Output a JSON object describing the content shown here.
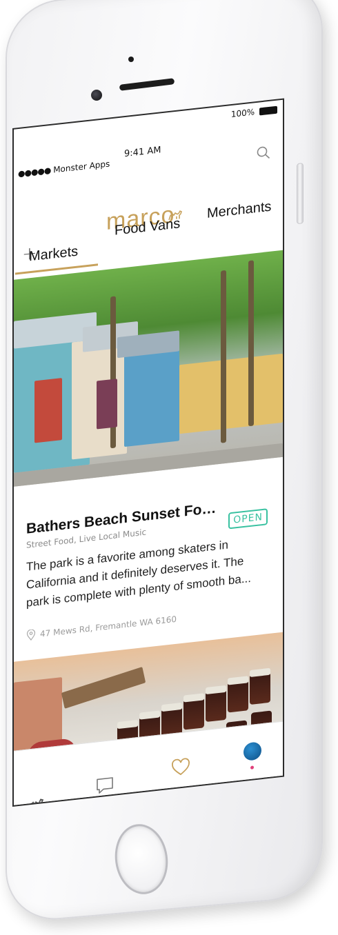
{
  "status_bar": {
    "carrier": "Monster Apps",
    "signal_dots": "●●●●●",
    "time": "9:41 AM",
    "battery": "100%"
  },
  "header": {
    "logo": "marco",
    "add_label": "+"
  },
  "tabs": [
    {
      "label": "Markets",
      "active": true
    },
    {
      "label": "Food Vans",
      "active": false
    },
    {
      "label": "Merchants",
      "active": false
    }
  ],
  "listings": [
    {
      "title": "Bathers Beach Sunset Food ...",
      "status": "OPEN",
      "tags": "Street Food, Live Local Music",
      "description": "The park is a favorite among skaters in California and it definitely deserves it. The park is complete with plenty of smooth ba...",
      "address": "47 Mews Rd, Fremantle WA 6160"
    }
  ],
  "tabbar": {
    "items": [
      "camel-icon",
      "chat-icon",
      "heart-icon",
      "profile-avatar"
    ]
  },
  "colors": {
    "brand_gold": "#c7a15b",
    "open_green": "#38c1a0",
    "notification_dot": "#e0407a"
  }
}
